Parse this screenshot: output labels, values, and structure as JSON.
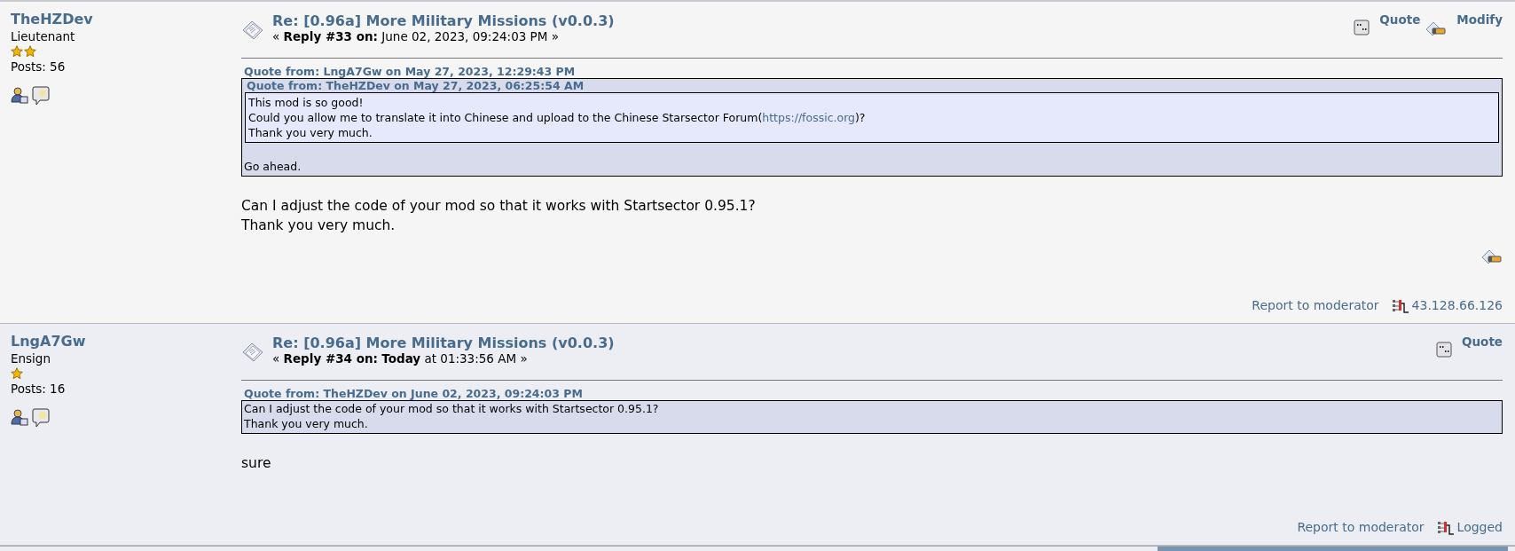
{
  "posts": [
    {
      "author": "TheHZDev",
      "rank": "Lieutenant",
      "rank_icons": [
        {
          "kind": "star"
        },
        {
          "kind": "star"
        }
      ],
      "post_count": "Posts: 56",
      "title": "Re: [0.96a] More Military Missions (v0.0.3)",
      "reply_info": "« **Reply #33 on:** June 02, 2023, 09:24:03 PM »",
      "actions": [
        {
          "kind": "quote",
          "label": "Quote"
        },
        {
          "kind": "modify",
          "label": "Modify"
        }
      ],
      "quote": {
        "header": "Quote from: LngA7Gw on May 27, 2023, 12:29:43 PM",
        "inner": {
          "header": "Quote from: TheHZDev on May 27, 2023, 06:25:54 AM",
          "lines": [
            {
              "text": "This mod is so good!"
            },
            {
              "text": "Could you allow me to translate it into Chinese and upload to the Chinese Starsector Forum(",
              "link": "https://fossic.org",
              "after": ")?"
            },
            {
              "text": "Thank you very much."
            }
          ]
        },
        "lines": [
          {
            "text": "Go ahead."
          }
        ]
      },
      "body": [
        "Can I adjust the code of your mod so that it works with Startsector 0.95.1?",
        "Thank you very much."
      ],
      "edited": true,
      "report": "Report to moderator",
      "ip": "43.128.66.126"
    },
    {
      "author": "LngA7Gw",
      "rank": "Ensign",
      "rank_icons": [
        {
          "kind": "star"
        }
      ],
      "post_count": "Posts: 16",
      "title": "Re: [0.96a] More Military Missions (v0.0.3)",
      "reply_info": "« **Reply #34 on:** **Today** at 01:33:56 AM »",
      "actions": [
        {
          "kind": "quote",
          "label": "Quote"
        }
      ],
      "quote": {
        "header": "Quote from: TheHZDev on June 02, 2023, 09:24:03 PM",
        "lines": [
          {
            "text": "Can I adjust the code of your mod so that it works with Startsector 0.95.1?"
          },
          {
            "text": "Thank you very much."
          }
        ]
      },
      "body": [
        "sure"
      ],
      "edited": false,
      "report": "Report to moderator",
      "ip": "Logged"
    }
  ]
}
